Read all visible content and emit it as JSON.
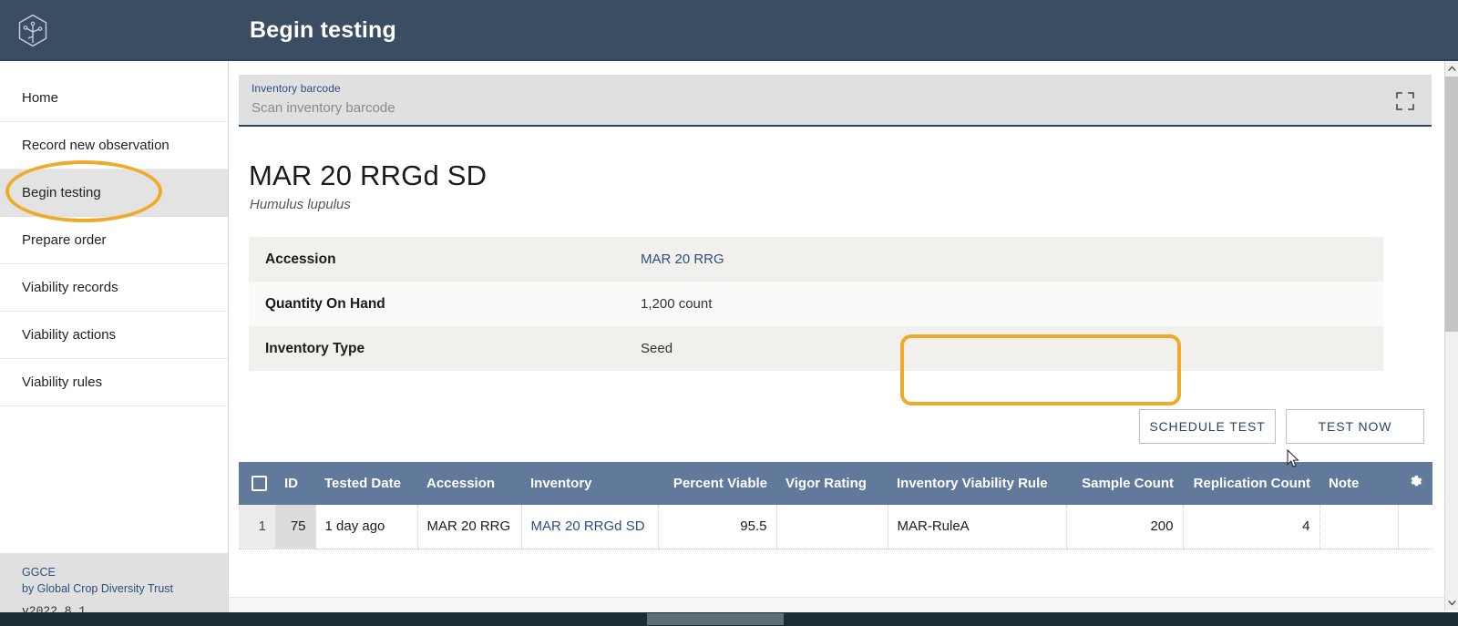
{
  "app": {
    "title": "Begin testing",
    "logo_icon": "hexagon-sprout-logo"
  },
  "sidebar": {
    "items": [
      {
        "label": "Home",
        "active": false
      },
      {
        "label": "Record new observation",
        "active": false
      },
      {
        "label": "Begin testing",
        "active": true
      },
      {
        "label": "Prepare order",
        "active": false
      },
      {
        "label": "Viability records",
        "active": false
      },
      {
        "label": "Viability actions",
        "active": false
      },
      {
        "label": "Viability rules",
        "active": false
      }
    ],
    "footer": {
      "brand": "GGCE",
      "by": "by Global Crop Diversity Trust",
      "version": "v2022.8.1"
    }
  },
  "barcode": {
    "label": "Inventory barcode",
    "placeholder": "Scan inventory barcode",
    "value": "",
    "expand_icon": "fullscreen-icon"
  },
  "record": {
    "title": "MAR 20 RRGd SD",
    "subtitle": "Humulus lupulus",
    "details": [
      {
        "key": "Accession",
        "value": "MAR 20 RRG",
        "is_link": true
      },
      {
        "key": "Quantity On Hand",
        "value": "1,200 count",
        "is_link": false
      },
      {
        "key": "Inventory Type",
        "value": "Seed",
        "is_link": false
      }
    ]
  },
  "actions": {
    "schedule_test": "SCHEDULE TEST",
    "test_now": "TEST NOW"
  },
  "grid": {
    "select_all_icon": "checkbox-unchecked-icon",
    "settings_icon": "gear-icon",
    "columns": [
      "ID",
      "Tested Date",
      "Accession",
      "Inventory",
      "Percent Viable",
      "Vigor Rating",
      "Inventory Viability Rule",
      "Sample Count",
      "Replication Count",
      "Note"
    ],
    "rows": [
      {
        "row_number": "1",
        "id": "75",
        "tested_date": "1 day ago",
        "accession": "MAR 20 RRG",
        "inventory": "MAR 20 RRGd SD",
        "percent_viable": "95.5",
        "vigor_rating": "",
        "inventory_viability_rule": "MAR-RuleA",
        "sample_count": "200",
        "replication_count": "4",
        "note": ""
      }
    ]
  },
  "colors": {
    "appbar": "#3b4d63",
    "grid_header": "#617a9b",
    "accent_link": "#2e4e7e",
    "highlight_ring": "#efab28",
    "sidebar_active": "#e3e3e3"
  }
}
